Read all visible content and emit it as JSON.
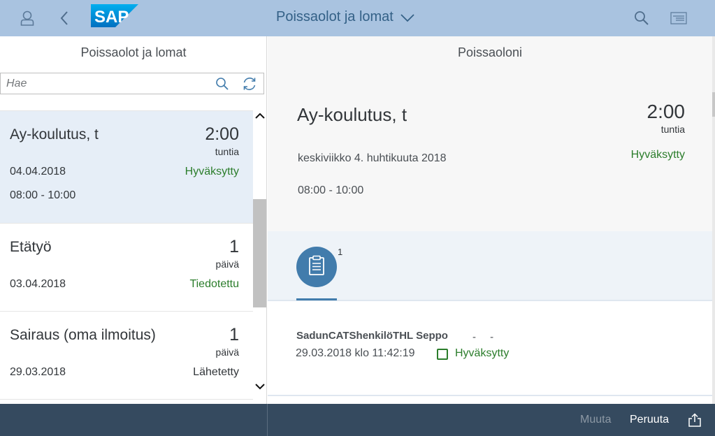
{
  "shell": {
    "title": "Poissaolot ja lomat",
    "logo_text": "SAP",
    "icons": [
      "user-icon",
      "back-icon",
      "search-icon",
      "menu-icon",
      "chevron-down-icon"
    ]
  },
  "master": {
    "title": "Poissaolot ja lomat",
    "search_placeholder": "Hae",
    "items": [
      {
        "title": "Ay-koulutus, t",
        "number": "2:00",
        "unit": "tuntia",
        "date": "04.04.2018",
        "status": "Hyväksytty",
        "time": "08:00 - 10:00",
        "selected": true
      },
      {
        "title": "Etätyö",
        "number": "1",
        "unit": "päivä",
        "date": "03.04.2018",
        "status": "Tiedotettu",
        "time": ""
      },
      {
        "title": "Sairaus (oma ilmoitus)",
        "number": "1",
        "unit": "päivä",
        "date": "29.03.2018",
        "status": "Lähetetty",
        "time": ""
      }
    ]
  },
  "detail": {
    "title": "Poissaoloni",
    "object_title": "Ay-koulutus, t",
    "number": "2:00",
    "unit": "tuntia",
    "status": "Hyväksytty",
    "date": "keskiviikko 4. huhtikuuta 2018",
    "time": "08:00 - 10:00",
    "tab_count": "1",
    "note": {
      "author": "SadunCATShenkilöTHL Seppo",
      "dashes": "- -",
      "timestamp": "29.03.2018 klo 11:42:19",
      "status": "Hyväksytty"
    }
  },
  "footer": {
    "edit_label": "Muuta",
    "cancel_label": "Peruuta"
  },
  "colors": {
    "shell_bg": "#a9c3e0",
    "footer_bg": "#354a5f",
    "positive": "#2b7d2b",
    "accent": "#427cac",
    "selected_row": "#e6eef7"
  }
}
